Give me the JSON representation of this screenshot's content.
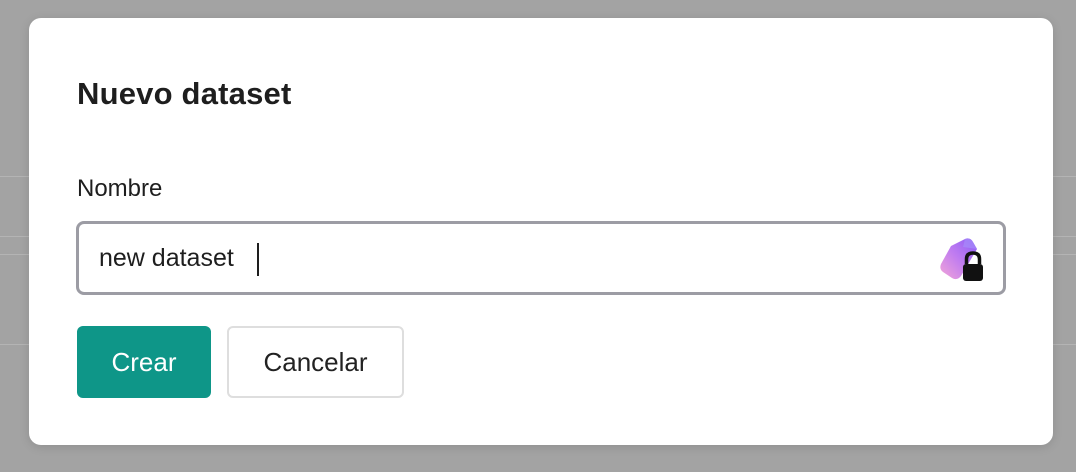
{
  "dialog": {
    "title": "Nuevo dataset",
    "name_field": {
      "label": "Nombre",
      "value": "new dataset",
      "password_manager_icon": "password-manager-lock-icon"
    },
    "buttons": {
      "create_label": "Crear",
      "cancel_label": "Cancelar"
    }
  },
  "colors": {
    "primary_button": "#0e9688",
    "overlay": "#a3a3a3",
    "input_border": "#9c9ca4"
  }
}
